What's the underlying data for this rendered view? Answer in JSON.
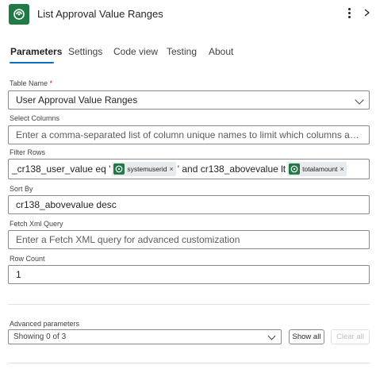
{
  "header": {
    "title": "List Approval Value Ranges",
    "menu_icon": "more-vertical-icon",
    "close_icon": "chevron-right-icon",
    "brand_color": "#1f7a45"
  },
  "tabs": [
    {
      "label": "Parameters",
      "active": true
    },
    {
      "label": "Settings"
    },
    {
      "label": "Code view"
    },
    {
      "label": "Testing"
    },
    {
      "label": "About"
    }
  ],
  "fields": {
    "table_name": {
      "label": "Table Name",
      "required_mark": "*",
      "value": "User Approval Value Ranges"
    },
    "select_columns": {
      "label": "Select Columns",
      "placeholder": "Enter a comma-separated list of column unique names to limit which columns are lis..."
    },
    "filter_rows": {
      "label": "Filter Rows",
      "part1": "_cr138_user_value eq '",
      "token1": "systemuserid",
      "part2": "' and cr138_abovevalue lt",
      "token2": "totalamount"
    },
    "sort_by": {
      "label": "Sort By",
      "value": "cr138_abovevalue desc"
    },
    "fetch_xml": {
      "label": "Fetch Xml Query",
      "placeholder": "Enter a Fetch XML query for advanced customization"
    },
    "row_count": {
      "label": "Row Count",
      "value": "1"
    }
  },
  "advanced": {
    "label": "Advanced parameters",
    "selected": "Showing 0 of 3",
    "show_all": "Show all",
    "clear_all": "Clear all"
  }
}
